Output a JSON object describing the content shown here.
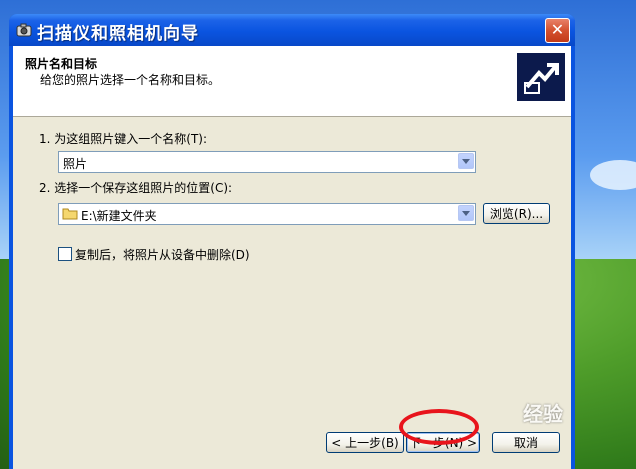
{
  "window": {
    "title": "扫描仪和照相机向导",
    "close_glyph": "✕"
  },
  "header": {
    "title": "照片名和目标",
    "subtitle": "给您的照片选择一个名称和目标。"
  },
  "step1": {
    "label": "1.  为这组照片键入一个名称(T):",
    "value": "照片"
  },
  "step2": {
    "label": "2.  选择一个保存这组照片的位置(C):",
    "value": "E:\\新建文件夹",
    "browse_label": "浏览(R)..."
  },
  "delete_option": {
    "label": "复制后，将照片从设备中删除(D)",
    "checked": false
  },
  "footer": {
    "back_label": "< 上一步(B)",
    "next_label": "下一步(N) >",
    "cancel_label": "取消"
  },
  "watermark": "经验",
  "colors": {
    "titlebar": "#0a54e0",
    "highlight": "#e8141c"
  },
  "icons": [
    "camera-icon",
    "close-icon",
    "wizard-icon",
    "folder-icon",
    "dropdown-arrow-icon"
  ]
}
